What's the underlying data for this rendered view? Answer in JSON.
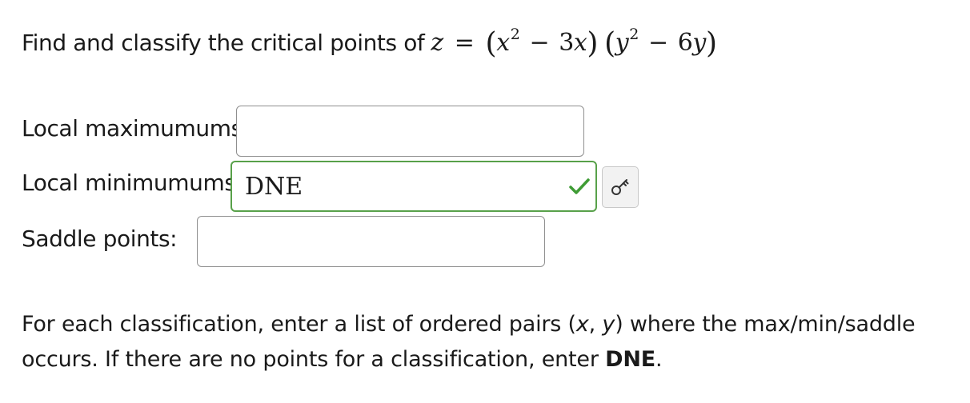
{
  "problem": {
    "prompt": "Find and classify the critical points of",
    "math": {
      "lhs": "z",
      "equals": "=",
      "x": "x",
      "x_exp": "2",
      "minus": "−",
      "coef_a": "3",
      "y": "y",
      "y_exp": "2",
      "coef_b": "6"
    }
  },
  "fields": {
    "local_max": {
      "label": "Local maximumums:",
      "value": ""
    },
    "local_min": {
      "label": "Local minimumums:",
      "value": "DNE"
    },
    "saddle": {
      "label": "Saddle points:",
      "value": ""
    }
  },
  "status": {
    "local_min_correct": true
  },
  "icons": {
    "check": "check-icon",
    "key": "key-icon"
  },
  "colors": {
    "correct_green": "#58a14a",
    "check_green": "#3f9c35"
  },
  "instructions": {
    "part1": "For each classification, enter a list of ordered pairs (",
    "x": "x",
    "sep": ", ",
    "y": "y",
    "part2": ") where the max/min/saddle occurs. If there are no points for a classification, enter ",
    "dne": "DNE",
    "end": "."
  }
}
